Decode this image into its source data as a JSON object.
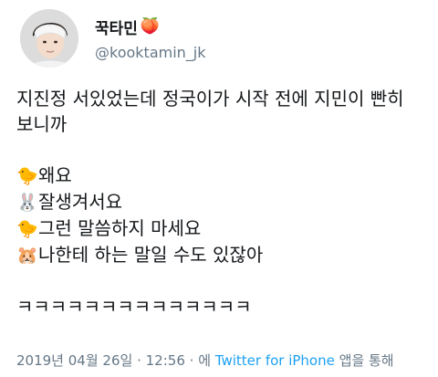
{
  "profile": {
    "display_name": "꾹타민",
    "name_emoji": "🍑",
    "handle": "@kooktamin_jk"
  },
  "tweet": {
    "line1": "지진정 서있었는데 정국이가 시작 전에 지민이 빤히",
    "line2": "보니까",
    "dialogue": [
      {
        "emoji": "🐤",
        "emoji_name": "chick-icon",
        "text": "왜요"
      },
      {
        "emoji": "🐰",
        "emoji_name": "rabbit-icon",
        "text": "잘생겨서요"
      },
      {
        "emoji": "🐤",
        "emoji_name": "chick-icon",
        "text": "그런 말씀하지 마세요"
      },
      {
        "emoji": "🐹",
        "emoji_name": "hamster-icon",
        "text": "나한테 하는 말일 수도 있잖아"
      }
    ],
    "laugh": "ㅋㅋㅋㅋㅋㅋㅋㅋㅋㅋㅋㅋㅋㅋ"
  },
  "meta": {
    "date": "2019년 04월 26일",
    "separator": "·",
    "time": "12:56",
    "via_prefix": "· 에",
    "source": "Twitter for iPhone",
    "via_suffix": "앱을 통해"
  }
}
